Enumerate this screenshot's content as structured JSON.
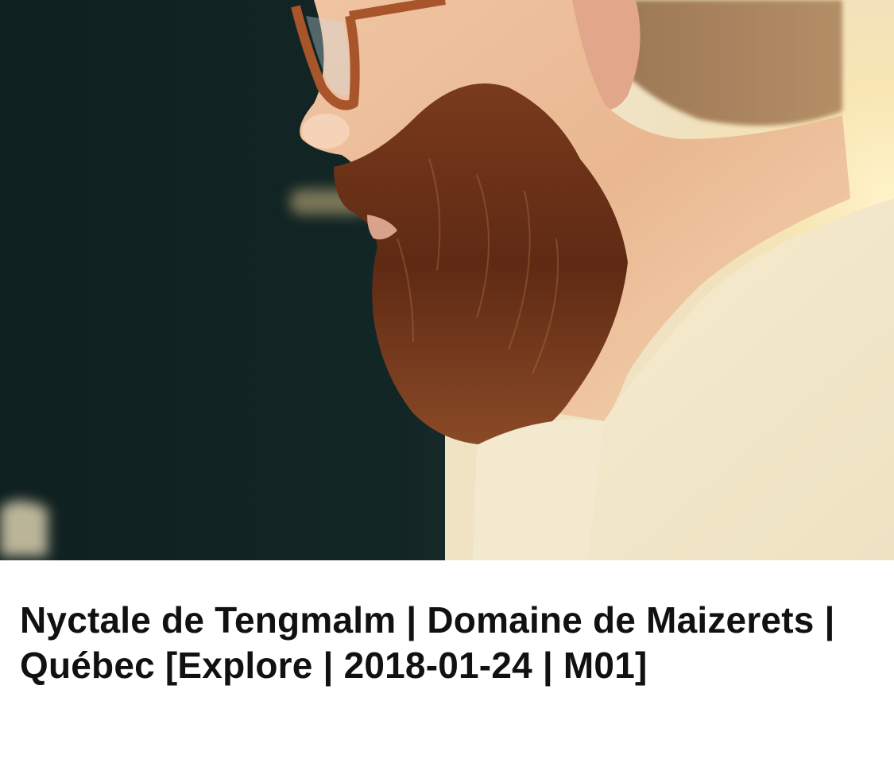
{
  "post": {
    "title": "Nyctale de Tengmalm | Domaine de Maizerets | Québec [Explore | 2018-01-24 | M01]"
  },
  "colors": {
    "background": "#ffffff",
    "title_text": "#111111"
  }
}
